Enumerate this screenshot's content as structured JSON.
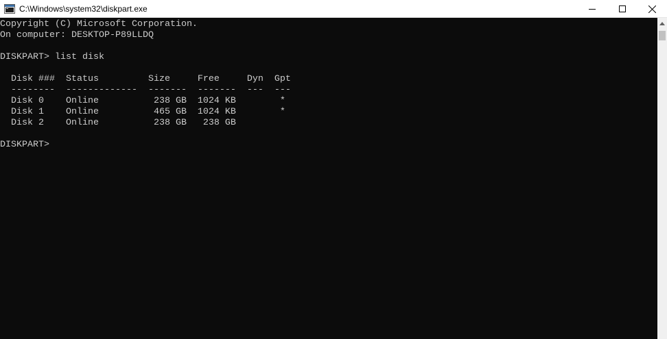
{
  "window": {
    "title": "C:\\Windows\\system32\\diskpart.exe"
  },
  "console": {
    "lines": [
      "Copyright (C) Microsoft Corporation.",
      "On computer: DESKTOP-P89LLDQ",
      "",
      "DISKPART> list disk",
      "",
      "  Disk ###  Status         Size     Free     Dyn  Gpt",
      "  --------  -------------  -------  -------  ---  ---",
      "  Disk 0    Online          238 GB  1024 KB        *",
      "  Disk 1    Online          465 GB  1024 KB        *",
      "  Disk 2    Online          238 GB   238 GB",
      "",
      "DISKPART> "
    ]
  },
  "colors": {
    "console_background": "#0c0c0c",
    "console_text": "#cccccc",
    "titlebar_background": "#ffffff"
  },
  "icons": {
    "app": "console-app-icon",
    "minimize": "minimize-icon",
    "maximize": "maximize-icon",
    "close": "close-icon",
    "scroll_up": "scroll-up-arrow-icon"
  }
}
